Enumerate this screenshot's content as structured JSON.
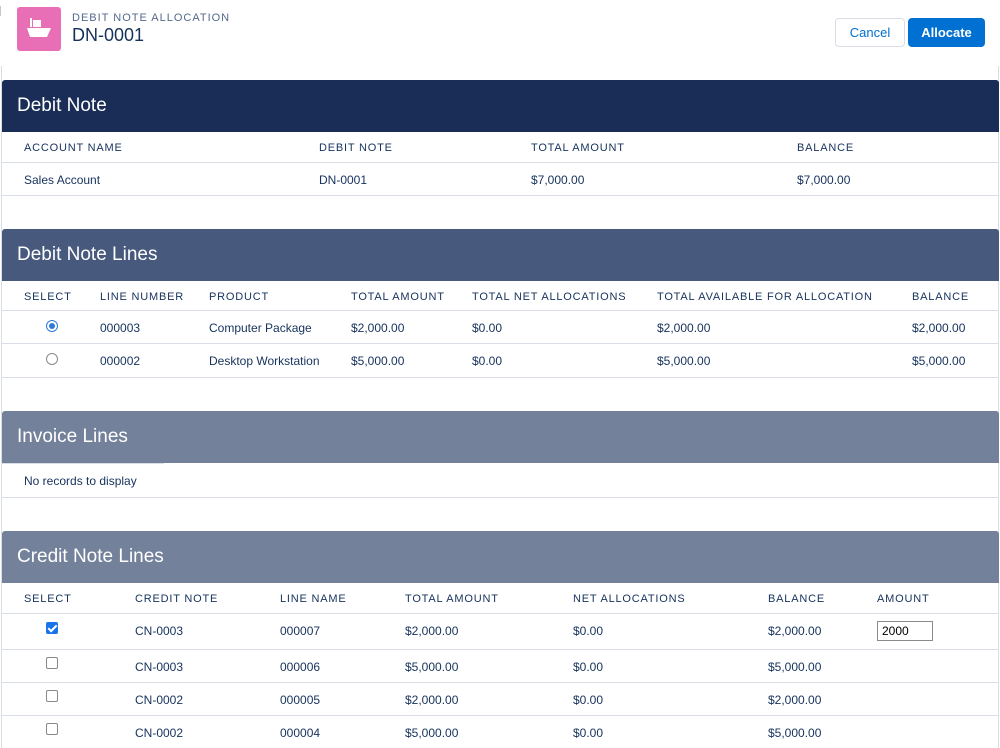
{
  "header": {
    "eyebrow": "DEBIT NOTE ALLOCATION",
    "title": "DN-0001",
    "icon": "ship-icon",
    "icon_color": "#e86fb5",
    "cancel_label": "Cancel",
    "allocate_label": "Allocate"
  },
  "debit_note": {
    "title": "Debit Note",
    "columns": [
      "ACCOUNT NAME",
      "DEBIT NOTE",
      "TOTAL AMOUNT",
      "BALANCE"
    ],
    "row": [
      "Sales Account",
      "DN-0001",
      "$7,000.00",
      "$7,000.00"
    ]
  },
  "debit_note_lines": {
    "title": "Debit Note Lines",
    "columns": [
      "SELECT",
      "LINE NUMBER",
      "PRODUCT",
      "TOTAL AMOUNT",
      "TOTAL NET ALLOCATIONS",
      "TOTAL AVAILABLE FOR ALLOCATION",
      "BALANCE"
    ],
    "rows": [
      {
        "selected": true,
        "cells": [
          "000003",
          "Computer Package",
          "$2,000.00",
          "$0.00",
          "$2,000.00",
          "$2,000.00"
        ]
      },
      {
        "selected": false,
        "cells": [
          "000002",
          "Desktop Workstation",
          "$5,000.00",
          "$0.00",
          "$5,000.00",
          "$5,000.00"
        ]
      }
    ]
  },
  "invoice_lines": {
    "title": "Invoice Lines",
    "empty_text": "No records to display"
  },
  "credit_note_lines": {
    "title": "Credit Note Lines",
    "columns": [
      "SELECT",
      "CREDIT NOTE",
      "LINE NAME",
      "TOTAL AMOUNT",
      "NET ALLOCATIONS",
      "BALANCE",
      "AMOUNT"
    ],
    "rows": [
      {
        "checked": true,
        "cells": [
          "CN-0003",
          "000007",
          "$2,000.00",
          "$0.00",
          "$2,000.00"
        ],
        "amount": "2000"
      },
      {
        "checked": false,
        "cells": [
          "CN-0003",
          "000006",
          "$5,000.00",
          "$0.00",
          "$5,000.00"
        ]
      },
      {
        "checked": false,
        "cells": [
          "CN-0002",
          "000005",
          "$2,000.00",
          "$0.00",
          "$2,000.00"
        ]
      },
      {
        "checked": false,
        "cells": [
          "CN-0002",
          "000004",
          "$5,000.00",
          "$0.00",
          "$5,000.00"
        ]
      }
    ]
  },
  "colors": {
    "section_dark": "#192d57",
    "section_mid": "#475a7d",
    "section_light": "#74819a",
    "brand_blue": "#0070d2"
  }
}
